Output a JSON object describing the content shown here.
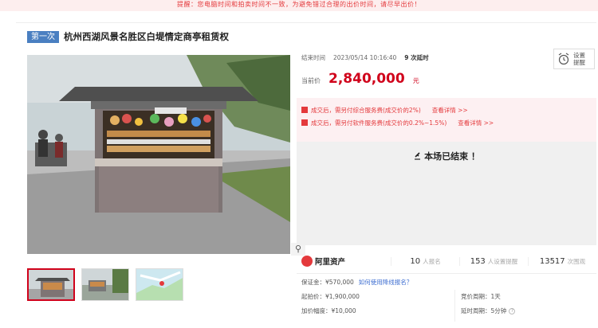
{
  "notice": "提醒：您电脑时间和拍卖时间不一致，为避免错过合理的出价时间，请尽早出价！",
  "item": {
    "round_tag": "第一次",
    "title": "杭州西湖风景名胜区白堤情定商亭租赁权"
  },
  "timing": {
    "end_label": "结束时间",
    "end_time": "2023/05/14 10:16:40",
    "delays": "9 次延时"
  },
  "remind": {
    "label": "设置提醒",
    "icon": "alarm-clock-icon"
  },
  "price": {
    "label": "当前价",
    "value": "2,840,000",
    "unit": "元"
  },
  "fees": [
    {
      "text": "成交后，需另付综合服务费(成交价的2%)",
      "link": "查看详情 >>"
    },
    {
      "text": "成交后，需另付软件服务费(成交价的0.2%~1.5%)",
      "link": "查看详情 >>"
    }
  ],
  "status": {
    "icon": "gavel-icon",
    "text": "本场已结束 ！"
  },
  "stats": {
    "brand": "阿里资产",
    "signups_num": "10",
    "signups_label": "人报名",
    "reminders_num": "153",
    "reminders_label": "人设置提醒",
    "views_num": "13517",
    "views_label": "次围观"
  },
  "details": {
    "deposit": "保证金：¥570,000",
    "deposit_link": "如何使用降线报名？",
    "start_price": "起拍价：¥1,900,000",
    "increment": "加价幅度：¥10,000",
    "bid_cycle": "竞价周期：1天",
    "delay_cycle": "延时周期：5分钟"
  },
  "gallery": {
    "zoom_icon": "magnifier-icon",
    "thumb_count": 3
  },
  "colors": {
    "accent": "#d0021b",
    "tag": "#4a7fc1",
    "link": "#3f6fd1"
  }
}
